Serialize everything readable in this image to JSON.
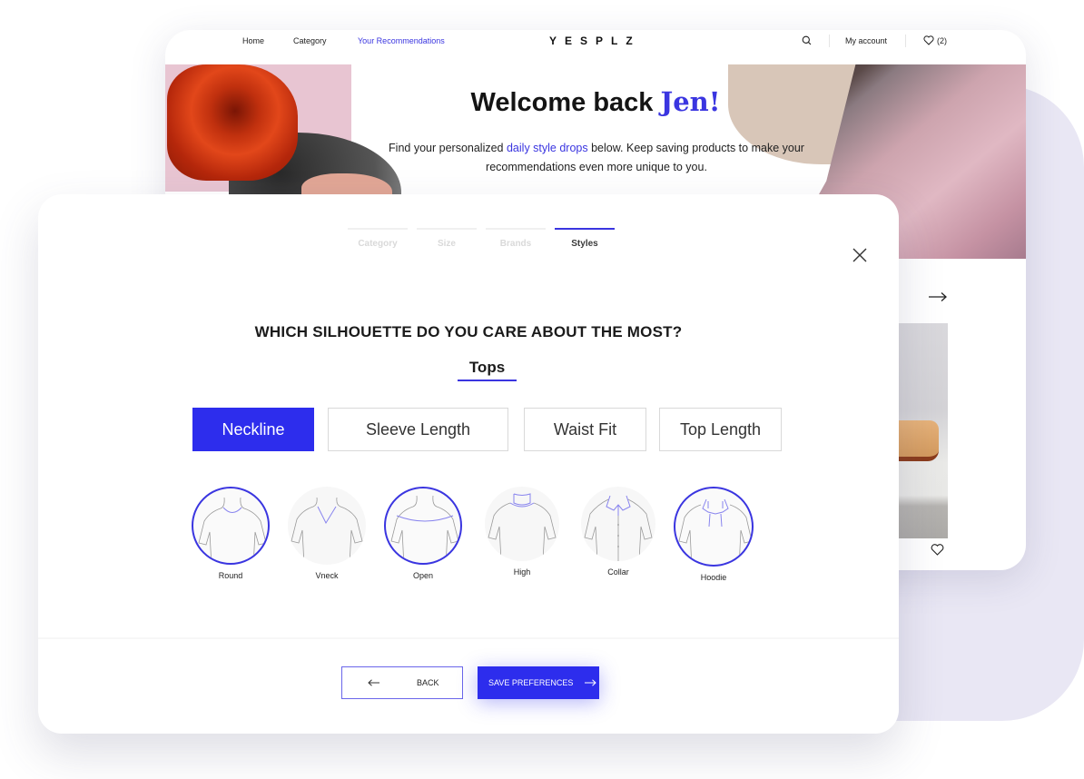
{
  "site": {
    "nav": {
      "links": [
        {
          "label": "Home",
          "active": false
        },
        {
          "label": "Category",
          "active": false
        },
        {
          "label": "Your Recommendations",
          "active": true
        }
      ],
      "logo": "YESPLZ",
      "search_icon": "search-icon",
      "account_label": "My account",
      "wishlist_icon": "heart-icon",
      "wishlist_count": "(2)"
    },
    "hero": {
      "title_prefix": "Welcome back ",
      "title_name": "Jen!",
      "subtitle_before": "Find your personalized ",
      "subtitle_highlight": "daily style drops",
      "subtitle_after": " below. Keep saving products to make your recommendations even more unique to you."
    },
    "carousel_next_icon": "arrow-right-icon",
    "product_heart_icon": "heart-icon"
  },
  "modal": {
    "steps": [
      {
        "label": "Category",
        "active": false
      },
      {
        "label": "Size",
        "active": false
      },
      {
        "label": "Brands",
        "active": false
      },
      {
        "label": "Styles",
        "active": true
      }
    ],
    "close_icon": "close-icon",
    "question": "WHICH SILHOUETTE DO YOU CARE ABOUT THE MOST?",
    "subtab": "Tops",
    "options": [
      {
        "label": "Neckline",
        "active": true
      },
      {
        "label": "Sleeve Length",
        "active": false
      },
      {
        "label": "Waist Fit",
        "active": false
      },
      {
        "label": "Top Length",
        "active": false
      }
    ],
    "shapes": [
      {
        "label": "Round",
        "selected": true
      },
      {
        "label": "Vneck",
        "selected": false
      },
      {
        "label": "Open",
        "selected": true
      },
      {
        "label": "High",
        "selected": false
      },
      {
        "label": "Collar",
        "selected": false
      },
      {
        "label": "Hoodie",
        "selected": true
      }
    ],
    "back_label": "BACK",
    "save_label": "SAVE PREFERENCES"
  },
  "colors": {
    "accent": "#2d2ded",
    "link": "#3a35e0",
    "background_blob": "#e9e7f4"
  }
}
